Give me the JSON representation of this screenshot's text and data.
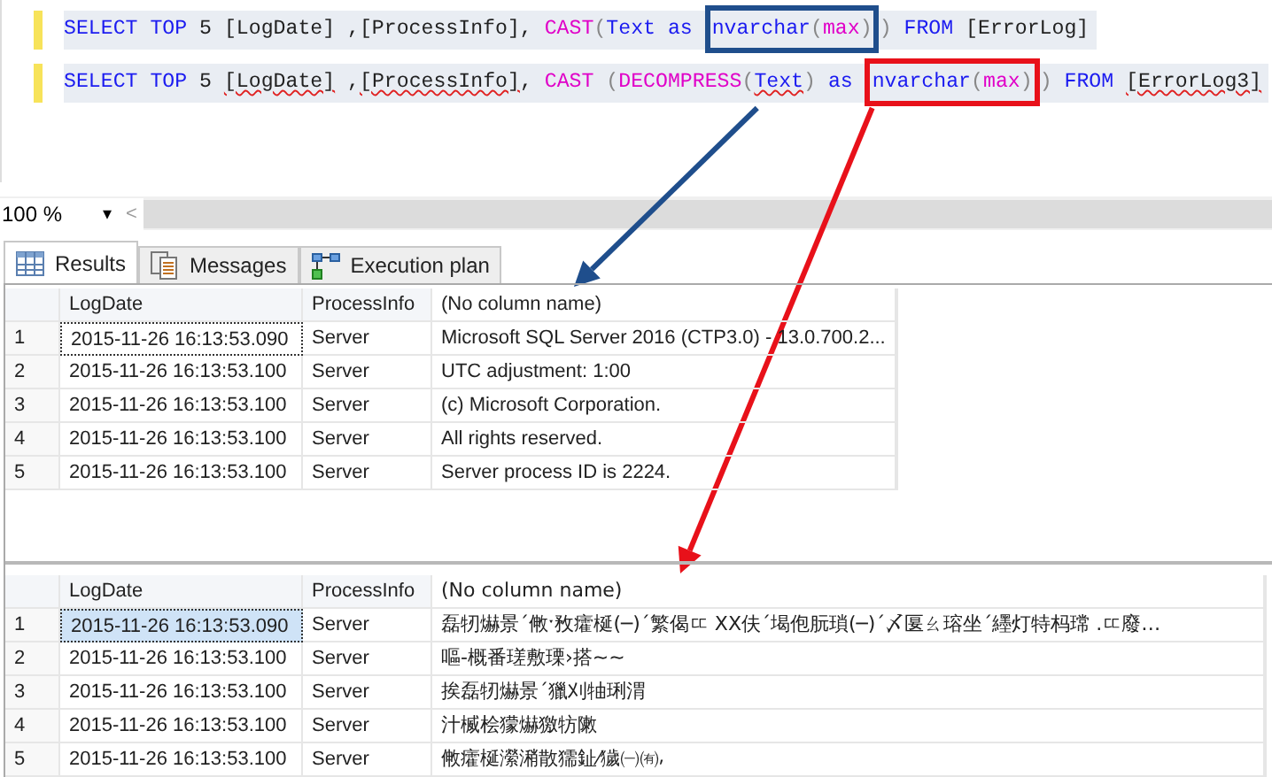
{
  "editor": {
    "lines": [
      {
        "changed": true,
        "before": [
          {
            "kind": "keyword",
            "text": "SELECT TOP "
          },
          {
            "kind": "plain",
            "text": "5 [LogDate] ,[ProcessInfo], "
          },
          {
            "kind": "function",
            "text": "CAST"
          },
          {
            "kind": "punct",
            "text": "("
          },
          {
            "kind": "keyword",
            "text": "Text as "
          }
        ],
        "callout": {
          "color": "#1f4e8c",
          "tokens": [
            {
              "kind": "keyword",
              "text": "nvarchar"
            },
            {
              "kind": "punct",
              "text": "("
            },
            {
              "kind": "function",
              "text": "max"
            },
            {
              "kind": "punct",
              "text": ")"
            }
          ]
        },
        "after": [
          {
            "kind": "punct",
            "text": ")"
          },
          {
            "kind": "keyword",
            "text": " FROM "
          },
          {
            "kind": "plain",
            "text": "[ErrorLog]"
          }
        ]
      },
      {
        "changed": true,
        "before": [
          {
            "kind": "keyword",
            "text": "SELECT TOP "
          },
          {
            "kind": "plain",
            "text": "5 "
          },
          {
            "kind": "error_plain",
            "text": "[LogDate]"
          },
          {
            "kind": "plain",
            "text": " ,"
          },
          {
            "kind": "error_plain",
            "text": "[ProcessInfo]"
          },
          {
            "kind": "plain",
            "text": ", "
          },
          {
            "kind": "function",
            "text": "CAST "
          },
          {
            "kind": "punct",
            "text": "("
          },
          {
            "kind": "function",
            "text": "DECOMPRESS"
          },
          {
            "kind": "punct",
            "text": "("
          },
          {
            "kind": "error_keyword",
            "text": "Text"
          },
          {
            "kind": "punct",
            "text": ")"
          },
          {
            "kind": "keyword",
            "text": " as "
          }
        ],
        "callout": {
          "color": "#e8111a",
          "tokens": [
            {
              "kind": "keyword",
              "text": "nvarchar"
            },
            {
              "kind": "punct",
              "text": "("
            },
            {
              "kind": "function",
              "text": "max"
            },
            {
              "kind": "punct",
              "text": ")"
            }
          ]
        },
        "after": [
          {
            "kind": "punct",
            "text": ")"
          },
          {
            "kind": "keyword",
            "text": " FROM "
          },
          {
            "kind": "error_plain",
            "text": "[ErrorLog3]"
          }
        ]
      }
    ]
  },
  "zoom": {
    "value": "100 %",
    "caret": "▾",
    "scroll_left": "<"
  },
  "tabs": [
    {
      "label": "Results",
      "selected": true
    },
    {
      "label": "Messages",
      "selected": false
    },
    {
      "label": "Execution plan",
      "selected": false
    }
  ],
  "grids": [
    {
      "active": false,
      "columns": [
        "LogDate",
        "ProcessInfo",
        "(No column name)"
      ],
      "rows": [
        {
          "number": "1",
          "focused": true,
          "cells": [
            "2015-11-26 16:13:53.090",
            "Server",
            "Microsoft SQL Server 2016 (CTP3.0) - 13.0.700.2..."
          ]
        },
        {
          "number": "2",
          "focused": false,
          "cells": [
            "2015-11-26 16:13:53.100",
            "Server",
            "UTC adjustment: 1:00"
          ]
        },
        {
          "number": "3",
          "focused": false,
          "cells": [
            "2015-11-26 16:13:53.100",
            "Server",
            "(c) Microsoft Corporation."
          ]
        },
        {
          "number": "4",
          "focused": false,
          "cells": [
            "2015-11-26 16:13:53.100",
            "Server",
            "All rights reserved."
          ]
        },
        {
          "number": "5",
          "focused": false,
          "cells": [
            "2015-11-26 16:13:53.100",
            "Server",
            "Server process ID is 2224."
          ]
        }
      ]
    },
    {
      "active": true,
      "columns": [
        "LogDate",
        "ProcessInfo",
        "(No column name)"
      ],
      "rows": [
        {
          "number": "1",
          "focused": true,
          "cells": [
            "2015-11-26 16:13:53.090",
            "Server",
            "磊牣爀景ˊ敒ˑ敄癨梴(─)ˊ繁偈ㄸ ⅩⅩ伕ˊ堨佨朊瑣(─)ˊ〆匽ㄠ瑢坐ˊ纆灯特杩瑺 .ㄸ廢…"
          ]
        },
        {
          "number": "2",
          "focused": false,
          "cells": [
            "2015-11-26 16:13:53.100",
            "Server",
            "嘔-概番瑳敷瑮›搭~~"
          ]
        },
        {
          "number": "3",
          "focused": false,
          "cells": [
            "2015-11-26 16:13:53.100",
            "Server",
            "挨磊牣爀景ˊ獵刈牰琍渭"
          ]
        },
        {
          "number": "4",
          "focused": false,
          "cells": [
            "2015-11-26 16:13:53.100",
            "Server",
            "汁楲桧獴爀獥牥敶"
          ]
        },
        {
          "number": "5",
          "focused": false,
          "cells": [
            "2015-11-26 16:13:53.100",
            "Server",
            "敒癨梴瀠潲散獳䤠⁄獩㈠㈲⸴"
          ]
        }
      ]
    }
  ]
}
